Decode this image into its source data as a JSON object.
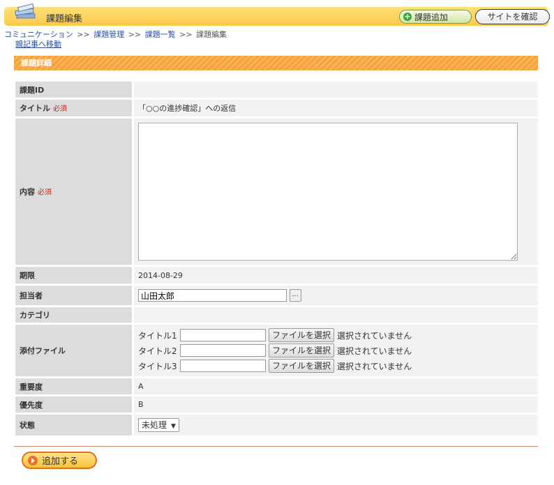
{
  "header": {
    "title": "課題編集",
    "add_button": "課題追加",
    "site_button": "サイトを確認"
  },
  "breadcrumb": {
    "items": [
      "コミュニケーション",
      "課題管理",
      "課題一覧"
    ],
    "current": "課題編集",
    "separator": ">>"
  },
  "parent_link": "親記事へ移動",
  "section": {
    "title": "課題詳細"
  },
  "form": {
    "id_label": "課題ID",
    "id_value": "",
    "title_label": "タイトル",
    "required": "必須",
    "title_value": "「○○の進捗確認」への返信",
    "content_label": "内容",
    "content_value": "",
    "deadline_label": "期限",
    "deadline_value": "2014-08-29",
    "assignee_label": "担当者",
    "assignee_value": "山田太郎",
    "assignee_button": "...",
    "category_label": "カテゴリ",
    "category_value": "",
    "attach_label": "添付ファイル",
    "attachments": [
      {
        "label": "タイトル1",
        "button": "ファイルを選択",
        "status": "選択されていません"
      },
      {
        "label": "タイトル2",
        "button": "ファイルを選択",
        "status": "選択されていません"
      },
      {
        "label": "タイトル3",
        "button": "ファイルを選択",
        "status": "選択されていません"
      }
    ],
    "importance_label": "重要度",
    "importance_value": "A",
    "priority_label": "優先度",
    "priority_value": "B",
    "status_label": "状態",
    "status_value": "未処理"
  },
  "submit_button": "追加する",
  "colors": {
    "header_bg": "#fcc94a",
    "section_bg": "#f6a23a",
    "required": "#d0201a",
    "link": "#2a4f9a",
    "submit_border": "#e0731a"
  }
}
